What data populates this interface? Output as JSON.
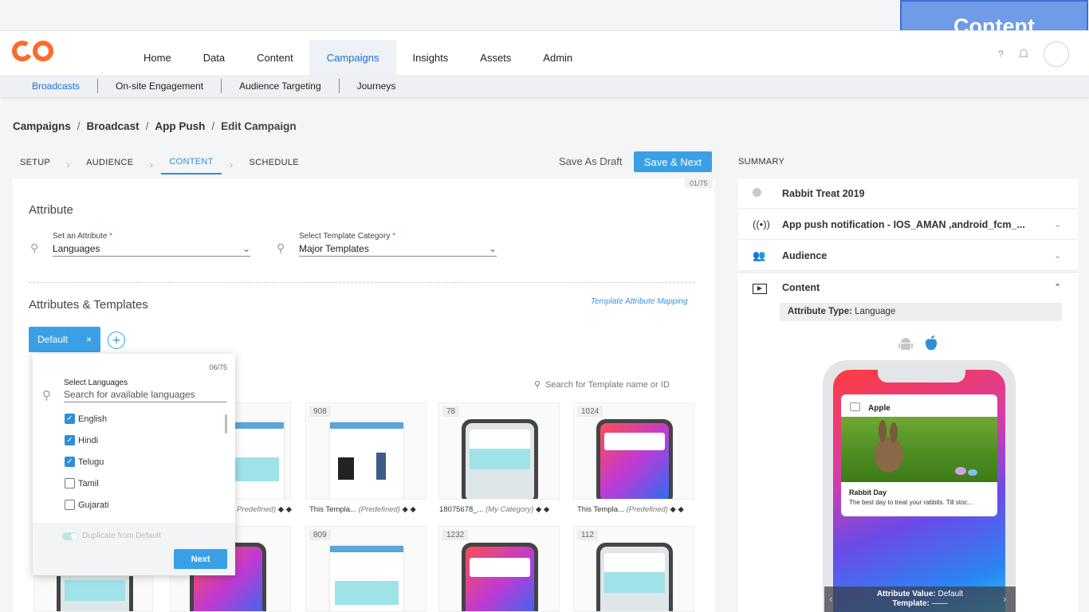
{
  "overlay": {
    "label": "Content"
  },
  "nav": {
    "items": [
      "Home",
      "Data",
      "Content",
      "Campaigns",
      "Insights",
      "Assets",
      "Admin"
    ],
    "active": "Campaigns",
    "help": "?"
  },
  "subnav": {
    "items": [
      "Broadcasts",
      "On-site Engagement",
      "Audience Targeting",
      "Journeys"
    ],
    "active": "Broadcasts"
  },
  "breadcrumb": [
    "Campaigns",
    "Broadcast",
    "App Push",
    "Edit Campaign"
  ],
  "breadcrumb_sep": "/",
  "steps": [
    "SETUP",
    "AUDIENCE",
    "CONTENT",
    "SCHEDULE"
  ],
  "actions": {
    "save_draft": "Save As Draft",
    "save_next": "Save & Next"
  },
  "summary_title": "SUMMARY",
  "main": {
    "counter": "01/75",
    "attribute_title": "Attribute",
    "attribute_field": {
      "label": "Set an Attribute",
      "value": "Languages"
    },
    "template_category_field": {
      "label": "Select Template Category",
      "value": "Major Templates"
    },
    "required_mark": "*",
    "attr_templates_title": "Attributes & Templates",
    "mapping_link": "Template Attribute Mapping",
    "default_chip": "Default",
    "chip_close": "×",
    "search_template_placeholder": "Search for Template name or ID"
  },
  "cards_row1": [
    {
      "id": "",
      "caption": "",
      "tag": "Predefined)"
    },
    {
      "id": "908",
      "caption": "This Templa...",
      "tag": "(Predefined)"
    },
    {
      "id": "78",
      "caption": "18075678_...",
      "tag": "(My Category)"
    },
    {
      "id": "1024",
      "caption": "This Templa...",
      "tag": "(Predefined)"
    }
  ],
  "cards_row2": [
    {
      "id": "809"
    },
    {
      "id": "1232"
    },
    {
      "id": "112"
    }
  ],
  "lang_pop": {
    "counter": "06/75",
    "label": "Select Languages",
    "placeholder": "Search for available languages",
    "languages": [
      {
        "name": "English",
        "checked": true
      },
      {
        "name": "Hindi",
        "checked": true
      },
      {
        "name": "Telugu",
        "checked": true
      },
      {
        "name": "Tamil",
        "checked": false
      },
      {
        "name": "Gujarati",
        "checked": false
      }
    ],
    "duplicate": "Duplicate from Default",
    "next": "Next"
  },
  "summary": {
    "campaign_name": "Rabbit Treat 2019",
    "channel": "App push notification - IOS_AMAN ,android_fcm_...",
    "audience": "Audience",
    "content": "Content",
    "attr_type_label": "Attribute Type:",
    "attr_type_value": "Language",
    "preview": {
      "app": "Apple",
      "title": "Rabbit Day",
      "body": "The best day to treat your rabbits. Till stoc...",
      "attr_value_label": "Attribute Value:",
      "attr_value": "Default",
      "template_label": "Template:",
      "template_value": "——"
    }
  },
  "colors": {
    "accent": "#3aa0e6",
    "brand": "#ff6a2b"
  }
}
